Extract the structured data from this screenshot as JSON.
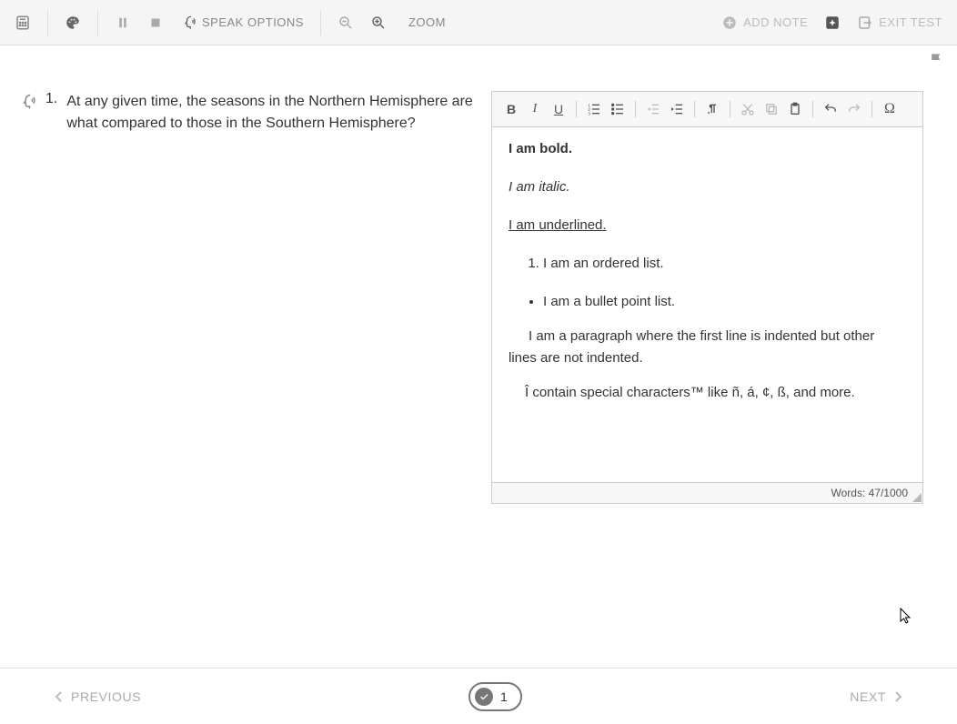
{
  "toolbar": {
    "speak_options_label": "SPEAK OPTIONS",
    "zoom_label": "ZOOM",
    "add_note_label": "ADD NOTE",
    "exit_test_label": "EXIT TEST"
  },
  "question": {
    "number": "1.",
    "text": "At any given time, the seasons in the Northern Hemisphere are what compared to those in the Southern Hemisphere?"
  },
  "editor": {
    "bold_line": "I am bold.",
    "italic_line": "I am italic.",
    "underline_line": "I am underlined.",
    "ordered_item": "I am an ordered list.",
    "bullet_item": "I am a bullet point list.",
    "indent_para": "I am a paragraph where the first line is indented but other lines are not indented.",
    "special_para": "Î contain special characters™ like ñ, á, ¢, ß, and more.",
    "word_count": "Words: 47/1000"
  },
  "footer": {
    "previous_label": "PREVIOUS",
    "next_label": "NEXT",
    "page_number": "1"
  }
}
